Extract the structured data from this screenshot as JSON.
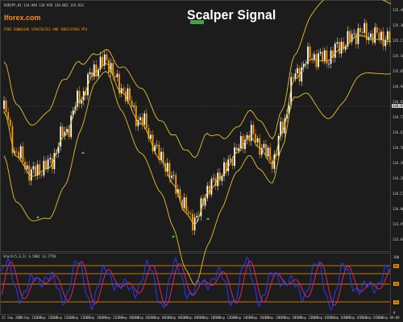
{
  "header": {
    "symbol_line": "EURJPY,H1  134.948 134.958 134.863 134.913",
    "site": "Iforex.com",
    "subtitle": "FREE DOWNLOAD STRATEGIES AND INDICATORS MT4",
    "title": "Scalper Signal"
  },
  "oscillator": {
    "label": "Stoch(5,3,3) 3.5862 13.7758"
  },
  "price_axis": {
    "labels": [
      "135.495",
      "135.385",
      "135.275",
      "135.165",
      "135.055",
      "134.945",
      "134.835",
      "134.725",
      "134.615",
      "134.505",
      "134.395",
      "134.285",
      "134.175",
      "134.065",
      "133.955",
      "133.845"
    ],
    "current": "134.913"
  },
  "osc_axis": {
    "labels": [
      "100",
      "80",
      "50",
      "20",
      "0"
    ]
  },
  "time_axis": {
    "labels": [
      "22 Sep 2016",
      "22 Sep 11:00",
      "22 Sep 13:00",
      "22 Sep 15:00",
      "22 Sep 17:00",
      "22 Sep 19:00",
      "22 Sep 21:00",
      "23 Sep 00:00",
      "23 Sep 02:00",
      "23 Sep 04:00",
      "23 Sep 06:00",
      "23 Sep 08:00",
      "23 Sep 10:00",
      "23 Sep 12:00",
      "23 Sep 14:00",
      "23 Sep 16:00",
      "23 Sep 18:00",
      "23 Sep 20:00",
      "23 Sep 22:00",
      "26 Sep 01:00",
      "26 Sep 03:00",
      "26 Sep 05:00",
      "26 Sep 07:00",
      "26 Sep 09:00"
    ]
  },
  "colors": {
    "background": "#1c1c1c",
    "bull_candle": "#ffffff",
    "bear_candle": "#ff9900",
    "band": "#e6c229",
    "stoch_main": "#1f3fff",
    "stoch_signal": "#e0206a",
    "level_line": "#ff9900",
    "signal_arrow": "#33cc33"
  }
}
